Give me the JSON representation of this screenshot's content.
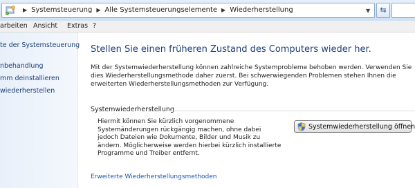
{
  "address_bar": {
    "breadcrumbs": [
      "Systemsteuerung",
      "Alle Systemsteuerungselemente",
      "Wiederherstellung"
    ],
    "refresh_icon": "refresh-icon"
  },
  "menu": {
    "items": [
      "arbeiten",
      "Ansicht",
      "Extras",
      "?"
    ]
  },
  "sidebar": {
    "items": [
      {
        "label": "te der Systemsteuerung"
      },
      {
        "label": "nbehandlung"
      },
      {
        "label": "mm deinstallieren"
      },
      {
        "label": "wiederherstellen"
      }
    ]
  },
  "main": {
    "title": "Stellen Sie einen früheren Zustand des Computers wieder her.",
    "description": "Mit der Systemwiederherstellung können zahlreiche Systemprobleme behoben werden. Verwenden Sie dies Wiederherstellungsmethode daher zuerst. Bei schwerwiegenden Problemen stehen Ihnen die erweiterten Wiederherstellungsmethoden zur Verfügung.",
    "section_title": "Systemwiederherstellung",
    "section_text": "Hiermit können Sie kürzlich vorgenommene Systemänderungen rückgängig machen, ohne dabei jedoch Dateien wie Dokumente, Bilder und Musik zu ändern. Möglicherweise werden hierbei kürzlich installierte Programme und Treiber entfernt.",
    "open_button": "Systemwiederherstellung öffnen",
    "advanced_link": "Erweiterte Wiederherstellungsmethoden"
  },
  "colors": {
    "link": "#1a55b0",
    "heading": "#1e3f7a",
    "sidebar_bg": "#e8f0fa"
  }
}
